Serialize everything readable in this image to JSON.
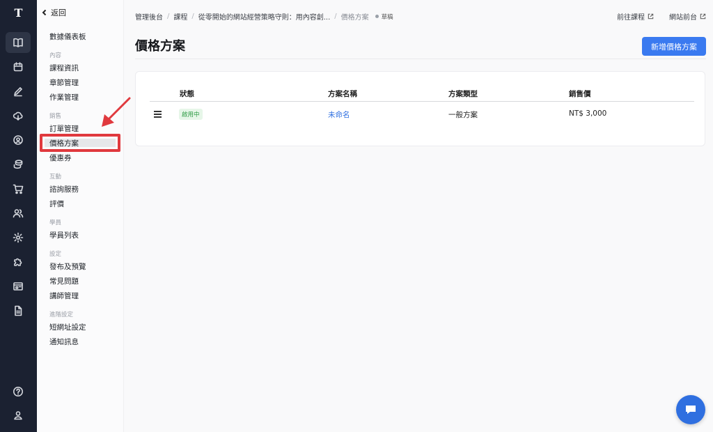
{
  "rail": {
    "logo": "T",
    "items": [
      "book-icon",
      "calendar-icon",
      "edit-icon",
      "cloud-download-icon",
      "support-icon",
      "coins-icon",
      "cart-icon",
      "users-icon",
      "settings-icon",
      "puzzle-icon",
      "layout-icon",
      "document-icon"
    ],
    "active_index": 0,
    "bottom": [
      "help-icon",
      "account-icon"
    ]
  },
  "subnav": {
    "back_label": "返回",
    "dashboard": "數據儀表板",
    "groups": {
      "content": "內容",
      "sales": "銷售",
      "interaction": "互動",
      "students": "學員",
      "settings": "設定",
      "advanced": "進階設定"
    },
    "items": {
      "course_info": "課程資訊",
      "chapters": "章節管理",
      "assignments": "作業管理",
      "orders": "訂單管理",
      "pricing": "價格方案",
      "coupons": "優惠券",
      "consulting": "諮詢服務",
      "reviews": "評價",
      "student_list": "學員列表",
      "publish": "發布及預覽",
      "faq": "常見問題",
      "instructors": "講師管理",
      "short_url": "短網址設定",
      "notifications": "通知訊息"
    },
    "selected": "pricing"
  },
  "breadcrumb": {
    "items": [
      "管理後台",
      "課程",
      "從零開始的網站經營策略守則：用內容創...",
      "價格方案"
    ],
    "status": "草稿"
  },
  "toplinks": {
    "view_course": "前往課程",
    "site_front": "網站前台"
  },
  "page": {
    "title": "價格方案",
    "add_button": "新增價格方案"
  },
  "table": {
    "headers": [
      "狀態",
      "方案名稱",
      "方案類型",
      "銷售價"
    ],
    "rows": [
      {
        "status": "啟用中",
        "name": "未命名",
        "type": "一般方案",
        "price": "NT$ 3,000"
      }
    ]
  },
  "colors": {
    "rail_bg": "#1b2131",
    "accent": "#3a7af0",
    "highlight": "#e0393e",
    "badge_green": "#2d9b44"
  }
}
